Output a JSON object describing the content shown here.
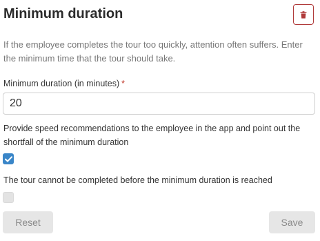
{
  "header": {
    "title": "Minimum duration",
    "delete_icon": "trash-icon",
    "accent_color": "#b03a3a"
  },
  "description": "If the employee completes the tour too quickly, attention often suffers. Enter the minimum time that the tour should take.",
  "minimum_duration": {
    "label": "Minimum duration (in minutes)",
    "required_marker": "*",
    "value": "20"
  },
  "speed_recommendations": {
    "label": "Provide speed recommendations to the employee in the app and point out the shortfall of the minimum duration",
    "checked": true,
    "checkbox_color": "#3a86c8"
  },
  "block_completion": {
    "label": "The tour cannot be completed before the minimum duration is reached",
    "checked": false
  },
  "actions": {
    "reset_label": "Reset",
    "save_label": "Save"
  }
}
